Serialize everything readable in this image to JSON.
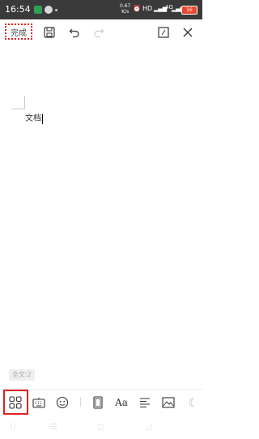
{
  "status_bar": {
    "time": "16:54",
    "speed_value": "0.67",
    "speed_unit": "K/s",
    "network": "HD",
    "signal": "4G",
    "battery": "16"
  },
  "toolbar": {
    "finish_label": "完成",
    "save_icon": "save-icon",
    "undo_icon": "undo-icon",
    "redo_icon": "redo-icon",
    "edit_icon": "edit-icon",
    "close_icon": "close-icon"
  },
  "document": {
    "text": "文档"
  },
  "word_count": "全文:2",
  "bottom_toolbar": {
    "items": [
      "apps-icon",
      "keyboard-icon",
      "emoji-icon",
      "page-icon",
      "font-icon",
      "align-icon",
      "image-icon",
      "more-icon"
    ],
    "font_label": "Aa"
  },
  "colors": {
    "highlight": "#e02020",
    "status_bar": "#3a3a3a",
    "battery": "#e8482e"
  }
}
